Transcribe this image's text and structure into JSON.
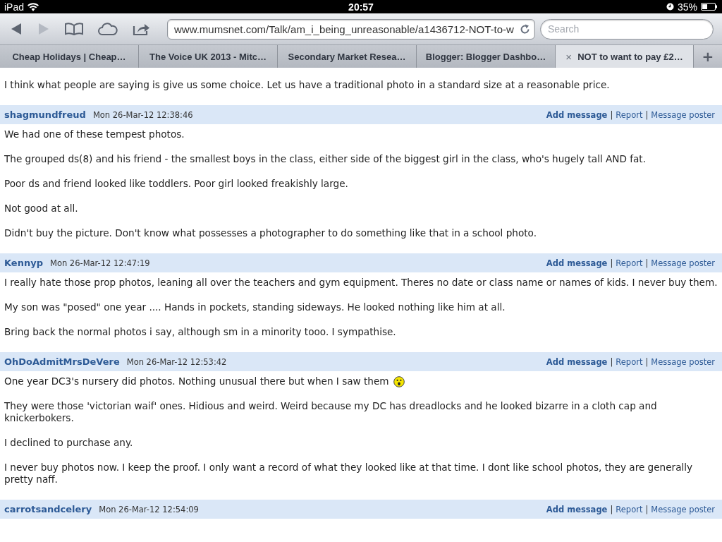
{
  "status_bar": {
    "device": "iPad",
    "time": "20:57",
    "battery": "35%"
  },
  "toolbar": {
    "back_enabled": true,
    "forward_enabled": false,
    "url": "www.mumsnet.com/Talk/am_i_being_unreasonable/a1436712-NOT-to-w",
    "search": {
      "placeholder": "Search"
    }
  },
  "tabs": [
    {
      "label": "Cheap Holidays | Cheap…",
      "selected": false
    },
    {
      "label": "The Voice UK 2013 - Mitc…",
      "selected": false
    },
    {
      "label": "Secondary Market Resea…",
      "selected": false
    },
    {
      "label": "Blogger: Blogger Dashbo…",
      "selected": false
    },
    {
      "label": "NOT to want to pay £2…",
      "selected": true,
      "close": "×"
    }
  ],
  "new_tab": "+",
  "intro": [
    {
      "text": "I think what people are saying is give us some choice. Let us have a traditional photo in a standard size at a reasonable price.",
      "emoticon": false
    }
  ],
  "posts": [
    {
      "author": "shagmundfreud",
      "date": "Mon 26-Mar-12 12:38:46",
      "actions": [
        {
          "label": "Add message",
          "kind": "bold"
        },
        {
          "sep": "|",
          "label": "Report",
          "kind": "plain"
        },
        {
          "sep": "|",
          "label": "Message poster",
          "kind": "plain"
        }
      ],
      "paragraphs": [
        {
          "text": "We had one of these tempest photos.",
          "emoticon": false
        },
        {
          "text": "The grouped ds(8) and his friend - the smallest boys in the class, either side of the biggest girl in the class, who's hugely tall AND fat.",
          "emoticon": false
        },
        {
          "text": "Poor ds and friend looked like toddlers. Poor girl looked freakishly large.",
          "emoticon": false
        },
        {
          "text": "Not good at all.",
          "emoticon": false
        },
        {
          "text": "Didn't buy the picture. Don't know what possesses a photographer to do something like that in a school photo.",
          "emoticon": false
        }
      ]
    },
    {
      "author": "Kennyp",
      "date": "Mon 26-Mar-12 12:47:19",
      "actions": [
        {
          "label": "Add message",
          "kind": "bold"
        },
        {
          "sep": "|",
          "label": "Report",
          "kind": "plain"
        },
        {
          "sep": "|",
          "label": "Message poster",
          "kind": "plain"
        }
      ],
      "paragraphs": [
        {
          "text": "I really hate those prop photos, leaning all over the teachers and gym equipment. Theres no date or class name or names of kids. I never buy them.",
          "emoticon": false
        },
        {
          "text": "My son was \"posed\" one year .... Hands in pockets, standing sideways. He looked nothing like him at all.",
          "emoticon": false
        },
        {
          "text": "Bring back the normal photos i say, although sm in a minority tooo. I sympathise.",
          "emoticon": false
        }
      ]
    },
    {
      "author": "OhDoAdmitMrsDeVere",
      "date": "Mon 26-Mar-12 12:53:42",
      "actions": [
        {
          "label": "Add message",
          "kind": "bold"
        },
        {
          "sep": "|",
          "label": "Report",
          "kind": "plain"
        },
        {
          "sep": "|",
          "label": "Message poster",
          "kind": "plain"
        }
      ],
      "paragraphs": [
        {
          "text": "One year DC3's nursery did photos. Nothing unusual there but when I saw them",
          "emoticon": true
        },
        {
          "text": "They were those 'victorian waif' ones. Hidious and weird. Weird because my DC has dreadlocks and he looked bizarre in a cloth cap and knickerbokers.",
          "emoticon": false
        },
        {
          "text": "I declined to purchase any.",
          "emoticon": false
        },
        {
          "text": "I never buy photos now. I keep the proof. I only want a record of what they looked like at that time. I dont like school photos, they are generally pretty naff.",
          "emoticon": false
        }
      ]
    },
    {
      "author": "carrotsandcelery",
      "date": "Mon 26-Mar-12 12:54:09",
      "actions": [
        {
          "label": "Add message",
          "kind": "bold"
        },
        {
          "sep": "|",
          "label": "Report",
          "kind": "plain"
        },
        {
          "sep": "|",
          "label": "Message poster",
          "kind": "plain"
        }
      ]
    }
  ]
}
